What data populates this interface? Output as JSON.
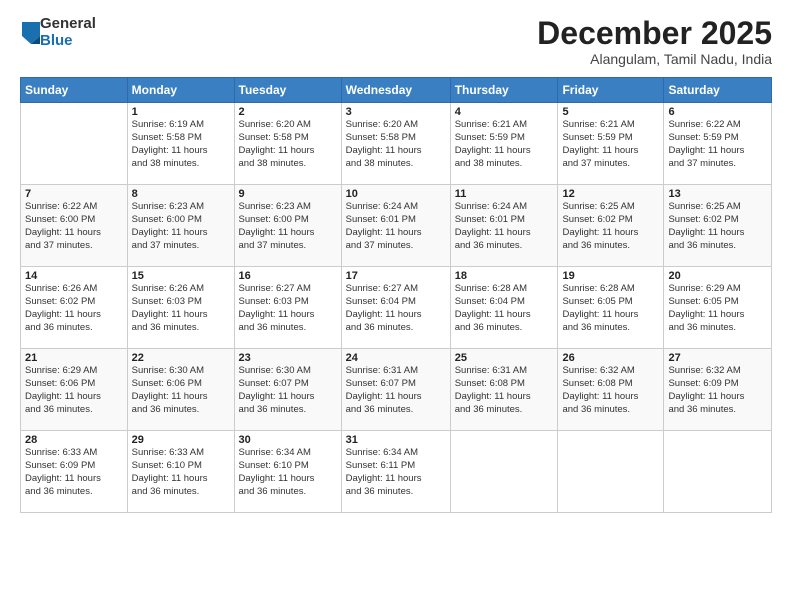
{
  "logo": {
    "general": "General",
    "blue": "Blue"
  },
  "title": "December 2025",
  "location": "Alangulam, Tamil Nadu, India",
  "headers": [
    "Sunday",
    "Monday",
    "Tuesday",
    "Wednesday",
    "Thursday",
    "Friday",
    "Saturday"
  ],
  "weeks": [
    [
      {
        "day": "",
        "info": ""
      },
      {
        "day": "1",
        "info": "Sunrise: 6:19 AM\nSunset: 5:58 PM\nDaylight: 11 hours\nand 38 minutes."
      },
      {
        "day": "2",
        "info": "Sunrise: 6:20 AM\nSunset: 5:58 PM\nDaylight: 11 hours\nand 38 minutes."
      },
      {
        "day": "3",
        "info": "Sunrise: 6:20 AM\nSunset: 5:58 PM\nDaylight: 11 hours\nand 38 minutes."
      },
      {
        "day": "4",
        "info": "Sunrise: 6:21 AM\nSunset: 5:59 PM\nDaylight: 11 hours\nand 38 minutes."
      },
      {
        "day": "5",
        "info": "Sunrise: 6:21 AM\nSunset: 5:59 PM\nDaylight: 11 hours\nand 37 minutes."
      },
      {
        "day": "6",
        "info": "Sunrise: 6:22 AM\nSunset: 5:59 PM\nDaylight: 11 hours\nand 37 minutes."
      }
    ],
    [
      {
        "day": "7",
        "info": "Sunrise: 6:22 AM\nSunset: 6:00 PM\nDaylight: 11 hours\nand 37 minutes."
      },
      {
        "day": "8",
        "info": "Sunrise: 6:23 AM\nSunset: 6:00 PM\nDaylight: 11 hours\nand 37 minutes."
      },
      {
        "day": "9",
        "info": "Sunrise: 6:23 AM\nSunset: 6:00 PM\nDaylight: 11 hours\nand 37 minutes."
      },
      {
        "day": "10",
        "info": "Sunrise: 6:24 AM\nSunset: 6:01 PM\nDaylight: 11 hours\nand 37 minutes."
      },
      {
        "day": "11",
        "info": "Sunrise: 6:24 AM\nSunset: 6:01 PM\nDaylight: 11 hours\nand 36 minutes."
      },
      {
        "day": "12",
        "info": "Sunrise: 6:25 AM\nSunset: 6:02 PM\nDaylight: 11 hours\nand 36 minutes."
      },
      {
        "day": "13",
        "info": "Sunrise: 6:25 AM\nSunset: 6:02 PM\nDaylight: 11 hours\nand 36 minutes."
      }
    ],
    [
      {
        "day": "14",
        "info": "Sunrise: 6:26 AM\nSunset: 6:02 PM\nDaylight: 11 hours\nand 36 minutes."
      },
      {
        "day": "15",
        "info": "Sunrise: 6:26 AM\nSunset: 6:03 PM\nDaylight: 11 hours\nand 36 minutes."
      },
      {
        "day": "16",
        "info": "Sunrise: 6:27 AM\nSunset: 6:03 PM\nDaylight: 11 hours\nand 36 minutes."
      },
      {
        "day": "17",
        "info": "Sunrise: 6:27 AM\nSunset: 6:04 PM\nDaylight: 11 hours\nand 36 minutes."
      },
      {
        "day": "18",
        "info": "Sunrise: 6:28 AM\nSunset: 6:04 PM\nDaylight: 11 hours\nand 36 minutes."
      },
      {
        "day": "19",
        "info": "Sunrise: 6:28 AM\nSunset: 6:05 PM\nDaylight: 11 hours\nand 36 minutes."
      },
      {
        "day": "20",
        "info": "Sunrise: 6:29 AM\nSunset: 6:05 PM\nDaylight: 11 hours\nand 36 minutes."
      }
    ],
    [
      {
        "day": "21",
        "info": "Sunrise: 6:29 AM\nSunset: 6:06 PM\nDaylight: 11 hours\nand 36 minutes."
      },
      {
        "day": "22",
        "info": "Sunrise: 6:30 AM\nSunset: 6:06 PM\nDaylight: 11 hours\nand 36 minutes."
      },
      {
        "day": "23",
        "info": "Sunrise: 6:30 AM\nSunset: 6:07 PM\nDaylight: 11 hours\nand 36 minutes."
      },
      {
        "day": "24",
        "info": "Sunrise: 6:31 AM\nSunset: 6:07 PM\nDaylight: 11 hours\nand 36 minutes."
      },
      {
        "day": "25",
        "info": "Sunrise: 6:31 AM\nSunset: 6:08 PM\nDaylight: 11 hours\nand 36 minutes."
      },
      {
        "day": "26",
        "info": "Sunrise: 6:32 AM\nSunset: 6:08 PM\nDaylight: 11 hours\nand 36 minutes."
      },
      {
        "day": "27",
        "info": "Sunrise: 6:32 AM\nSunset: 6:09 PM\nDaylight: 11 hours\nand 36 minutes."
      }
    ],
    [
      {
        "day": "28",
        "info": "Sunrise: 6:33 AM\nSunset: 6:09 PM\nDaylight: 11 hours\nand 36 minutes."
      },
      {
        "day": "29",
        "info": "Sunrise: 6:33 AM\nSunset: 6:10 PM\nDaylight: 11 hours\nand 36 minutes."
      },
      {
        "day": "30",
        "info": "Sunrise: 6:34 AM\nSunset: 6:10 PM\nDaylight: 11 hours\nand 36 minutes."
      },
      {
        "day": "31",
        "info": "Sunrise: 6:34 AM\nSunset: 6:11 PM\nDaylight: 11 hours\nand 36 minutes."
      },
      {
        "day": "",
        "info": ""
      },
      {
        "day": "",
        "info": ""
      },
      {
        "day": "",
        "info": ""
      }
    ]
  ]
}
